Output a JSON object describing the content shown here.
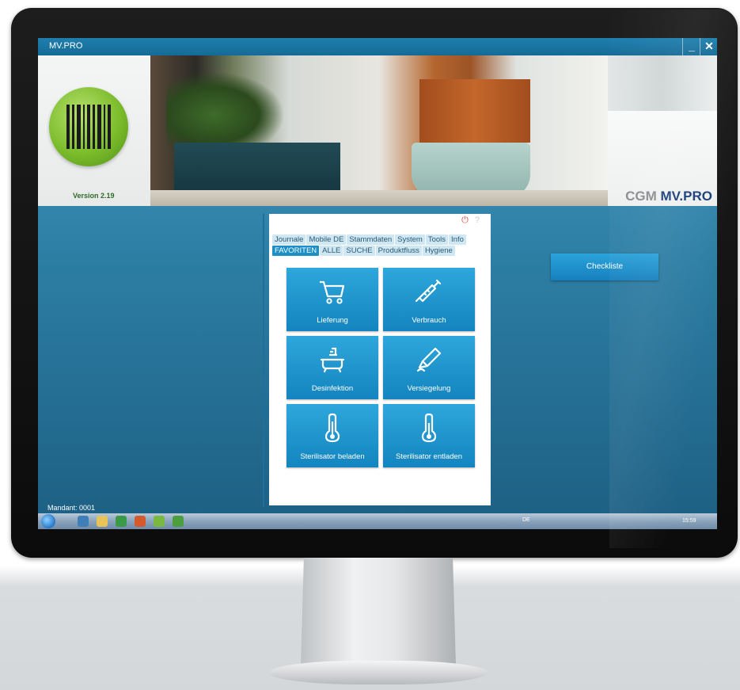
{
  "window": {
    "title": "MV.PRO",
    "minimize_label": "_",
    "close_label": "✕"
  },
  "header": {
    "version": "Version 2.19",
    "brand_cgm": "CGM",
    "brand_mvpro": "MV.PRO"
  },
  "panel": {
    "help_label": "?",
    "tabs_row1": [
      "Journale",
      "Mobile DE",
      "Stammdaten",
      "System",
      "Tools",
      "Info"
    ],
    "tabs_row2": [
      "FAVORITEN",
      "ALLE",
      "SUCHE",
      "Produktfluss",
      "Hygiene"
    ],
    "active_tab": "FAVORITEN",
    "tiles": [
      {
        "label": "Lieferung",
        "icon": "cart-icon"
      },
      {
        "label": "Verbrauch",
        "icon": "syringe-icon"
      },
      {
        "label": "Desinfektion",
        "icon": "bathtub-icon"
      },
      {
        "label": "Versiegelung",
        "icon": "sealing-icon"
      },
      {
        "label": "Sterilisator beladen",
        "icon": "thermometer-icon"
      },
      {
        "label": "Sterilisator entladen",
        "icon": "thermometer-icon"
      }
    ]
  },
  "checklist_button": "Checkliste",
  "status": {
    "mandant": "Mandant: 0001"
  },
  "taskbar": {
    "language": "DE",
    "clock": "15:59"
  },
  "colors": {
    "accent": "#1c8fc4",
    "tile": "#1a93cc",
    "logo_green": "#7cbd2c",
    "brand_blue": "#1b3f7a"
  }
}
